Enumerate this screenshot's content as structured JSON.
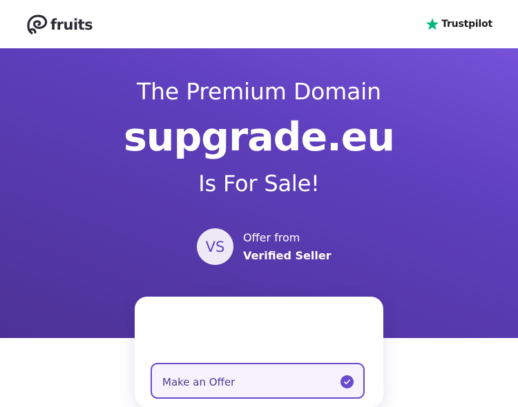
{
  "header": {
    "brand": "fruits",
    "trustpilot_label": "Trustpilot"
  },
  "hero": {
    "line1": "The Premium Domain",
    "domain": "supgrade.eu",
    "line3": "Is For Sale!"
  },
  "seller": {
    "avatar_initials": "VS",
    "offer_from": "Offer from",
    "name": "Verified Seller"
  },
  "offer_card": {
    "option_label": "Make an Offer",
    "option_selected": true
  },
  "colors": {
    "accent": "#6a4bcf",
    "trustpilot_green": "#00b67a",
    "hero_gradient_start": "#7552d8",
    "hero_gradient_end": "#4d3296"
  }
}
